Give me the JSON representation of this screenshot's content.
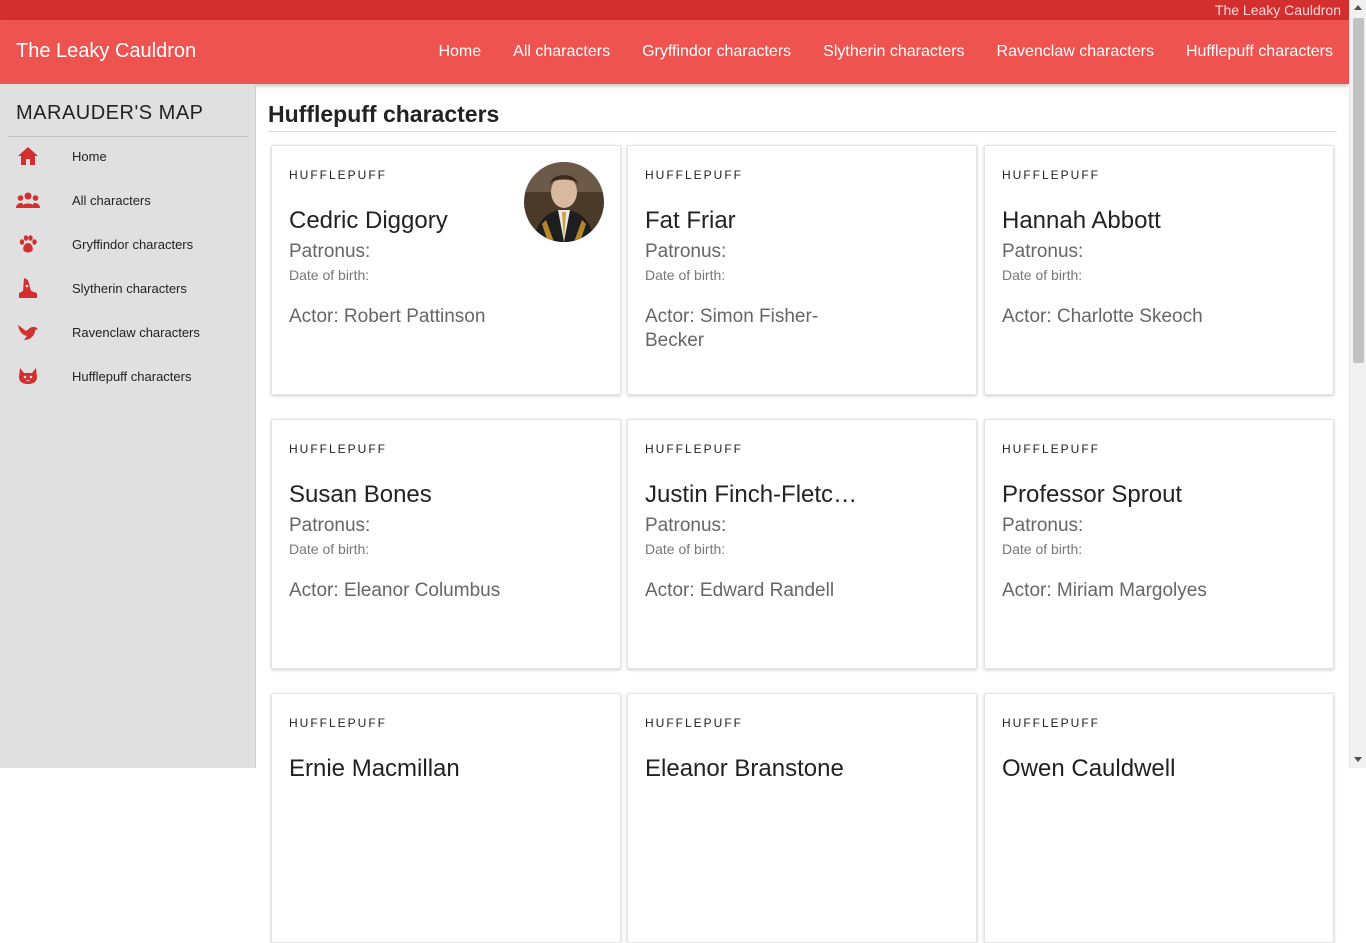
{
  "window_title": "The Leaky Cauldron",
  "appbar": {
    "brand": "The Leaky Cauldron",
    "nav": [
      "Home",
      "All characters",
      "Gryffindor characters",
      "Slytherin characters",
      "Ravenclaw characters",
      "Hufflepuff characters"
    ]
  },
  "sidebar": {
    "title": "MARAUDER'S MAP",
    "items": [
      {
        "label": "Home",
        "icon": "home-icon"
      },
      {
        "label": "All characters",
        "icon": "people-icon"
      },
      {
        "label": "Gryffindor characters",
        "icon": "paw-icon"
      },
      {
        "label": "Slytherin characters",
        "icon": "hat-icon"
      },
      {
        "label": "Ravenclaw characters",
        "icon": "bird-icon"
      },
      {
        "label": "Hufflepuff characters",
        "icon": "cat-icon"
      }
    ]
  },
  "main": {
    "title": "Hufflepuff characters",
    "cards": [
      {
        "house": "HUFFLEPUFF",
        "name": "Cedric Diggory",
        "patronus": "Patronus:",
        "dob": "Date of birth:",
        "actor": "Actor: Robert Pattinson",
        "has_image": true
      },
      {
        "house": "HUFFLEPUFF",
        "name": "Fat Friar",
        "patronus": "Patronus:",
        "dob": "Date of birth:",
        "actor": "Actor: Simon Fisher-Becker",
        "has_image": false
      },
      {
        "house": "HUFFLEPUFF",
        "name": "Hannah Abbott",
        "patronus": "Patronus:",
        "dob": "Date of birth:",
        "actor": "Actor: Charlotte Skeoch",
        "has_image": false
      },
      {
        "house": "HUFFLEPUFF",
        "name": "Susan Bones",
        "patronus": "Patronus:",
        "dob": "Date of birth:",
        "actor": "Actor: Eleanor Columbus",
        "has_image": false
      },
      {
        "house": "HUFFLEPUFF",
        "name": "Justin Finch-Fletchley",
        "patronus": "Patronus:",
        "dob": "Date of birth:",
        "actor": "Actor: Edward Randell",
        "has_image": false
      },
      {
        "house": "HUFFLEPUFF",
        "name": "Professor Sprout",
        "patronus": "Patronus:",
        "dob": "Date of birth:",
        "actor": "Actor: Miriam Margolyes",
        "has_image": false
      },
      {
        "house": "HUFFLEPUFF",
        "name": "Ernie Macmillan",
        "patronus": "",
        "dob": "",
        "actor": "",
        "has_image": false
      },
      {
        "house": "HUFFLEPUFF",
        "name": "Eleanor Branstone",
        "patronus": "",
        "dob": "",
        "actor": "",
        "has_image": false
      },
      {
        "house": "HUFFLEPUFF",
        "name": "Owen Cauldwell",
        "patronus": "",
        "dob": "",
        "actor": "",
        "has_image": false
      }
    ]
  },
  "colors": {
    "topstrip": "#d32f2f",
    "appbar": "#ef5350",
    "sidebar_icon": "#d32f2f",
    "sidebar_bg": "#e0e0e0"
  }
}
